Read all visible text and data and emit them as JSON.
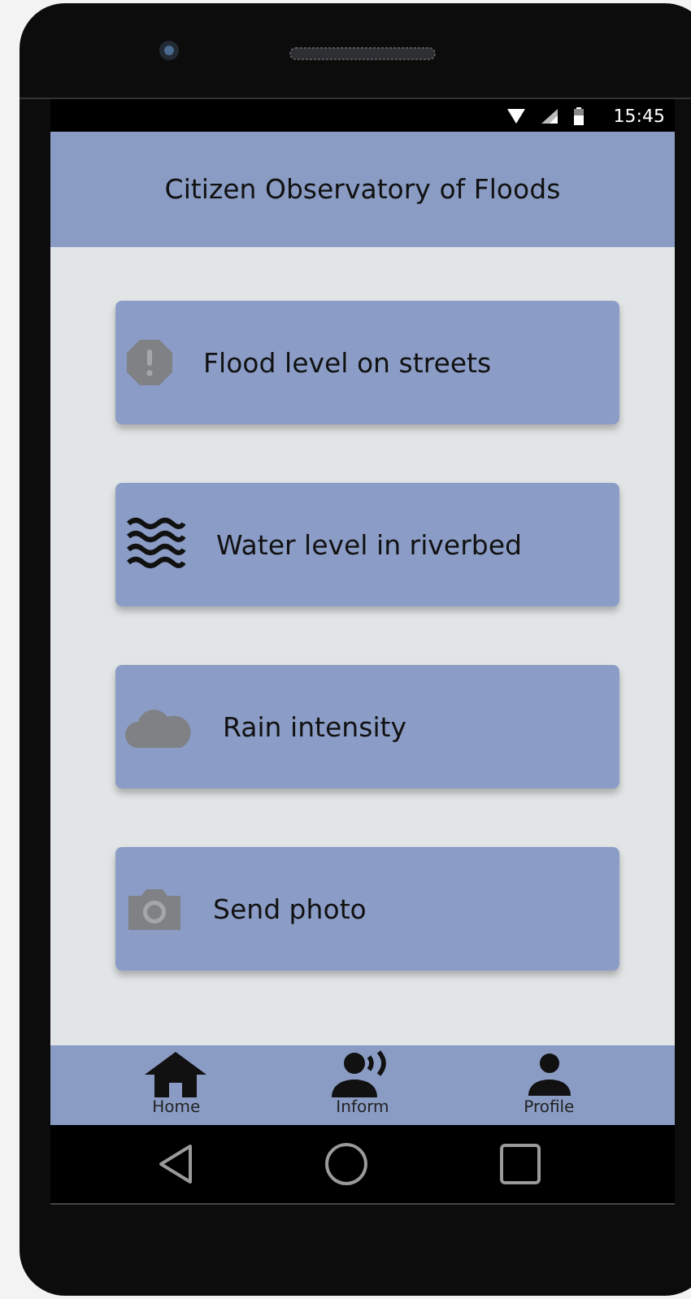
{
  "status_bar": {
    "time": "15:45"
  },
  "app_bar": {
    "title": "Citizen Observatory of Floods"
  },
  "menu": [
    {
      "label": "Flood level on streets",
      "kind": "warning"
    },
    {
      "label": "Water level in riverbed",
      "kind": "waves"
    },
    {
      "label": "Rain intensity",
      "kind": "cloud"
    },
    {
      "label": "Send photo",
      "kind": "camera"
    }
  ],
  "bottom_nav": [
    {
      "label": "Home",
      "kind": "home"
    },
    {
      "label": "Inform",
      "kind": "inform"
    },
    {
      "label": "Profile",
      "kind": "profile"
    }
  ]
}
